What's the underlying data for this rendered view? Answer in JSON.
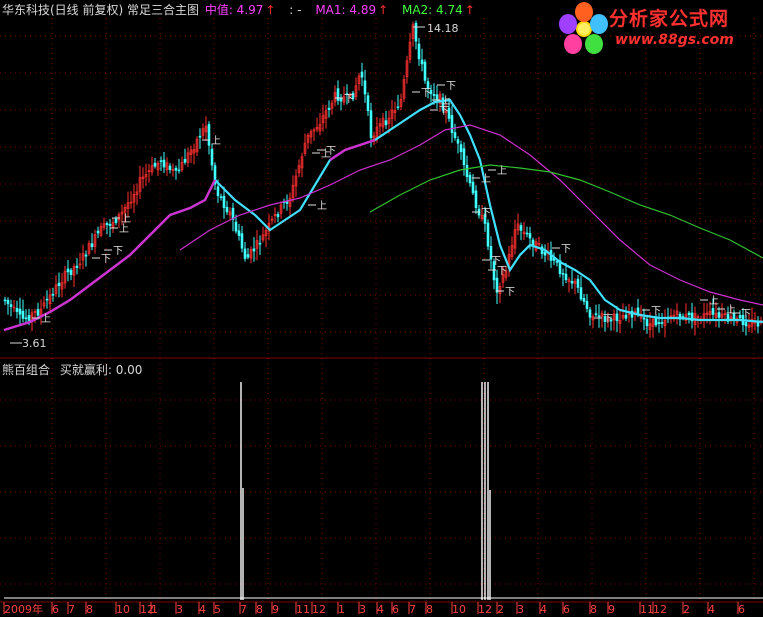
{
  "header": {
    "title": "华东科技(日线 前复权) 常足三合主图",
    "mid_label": "中值: 4.97",
    "colon": ": -",
    "ma1_label": "MA1: 4.89",
    "ma2_label": "MA2: 4.74",
    "arrow": "↑"
  },
  "price_labels": {
    "high": "14.18",
    "low": "3.61"
  },
  "sub_header": {
    "name": "熊百组合",
    "label": "买就赢利: 0.00"
  },
  "logo": {
    "name": "分析家公式网",
    "url": "www.88gs.com"
  },
  "signals": {
    "up": "上",
    "down": "下"
  },
  "time_axis": [
    "2009年",
    "6",
    "7",
    "8",
    "10",
    "12",
    "1",
    "3",
    "4",
    "5",
    "7",
    "8",
    "9",
    "11",
    "12",
    "1",
    "3",
    "4",
    "6",
    "7",
    "8",
    "10",
    "12",
    "2",
    "3",
    "4",
    "6",
    "8",
    "9",
    "11",
    "12",
    "2",
    "4",
    "6"
  ],
  "colors": {
    "background": "#000000",
    "up_candle": "#ff3030",
    "down_candle": "#40ffff",
    "ma_cyan": "#40e0ff",
    "ma_magenta": "#d030d0",
    "ma_green": "#30c030",
    "grid": "#800000",
    "axis": "#ff4040"
  }
}
